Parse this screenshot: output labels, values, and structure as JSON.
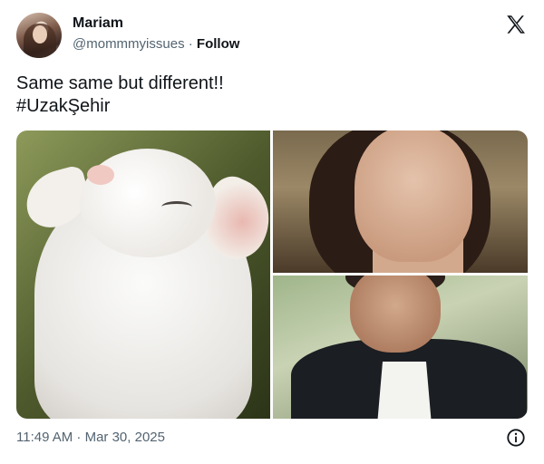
{
  "author": {
    "name": "Mariam",
    "handle": "@mommmyissues",
    "separator": "·",
    "follow_label": "Follow"
  },
  "platform_icon": "x-logo-icon",
  "tweet": {
    "text_line_1": "Same same but different!!",
    "text_line_2": "#UzakŞehir"
  },
  "media": [
    {
      "name": "goat-photo",
      "description_icon": "image"
    },
    {
      "name": "woman-photo",
      "description_icon": "image"
    },
    {
      "name": "man-photo",
      "description_icon": "image"
    }
  ],
  "footer": {
    "timestamp": "11:49 AM · Mar 30, 2025",
    "info_icon": "info-icon"
  },
  "colors": {
    "text_primary": "#0f1419",
    "text_secondary": "#536471",
    "background": "#ffffff"
  }
}
